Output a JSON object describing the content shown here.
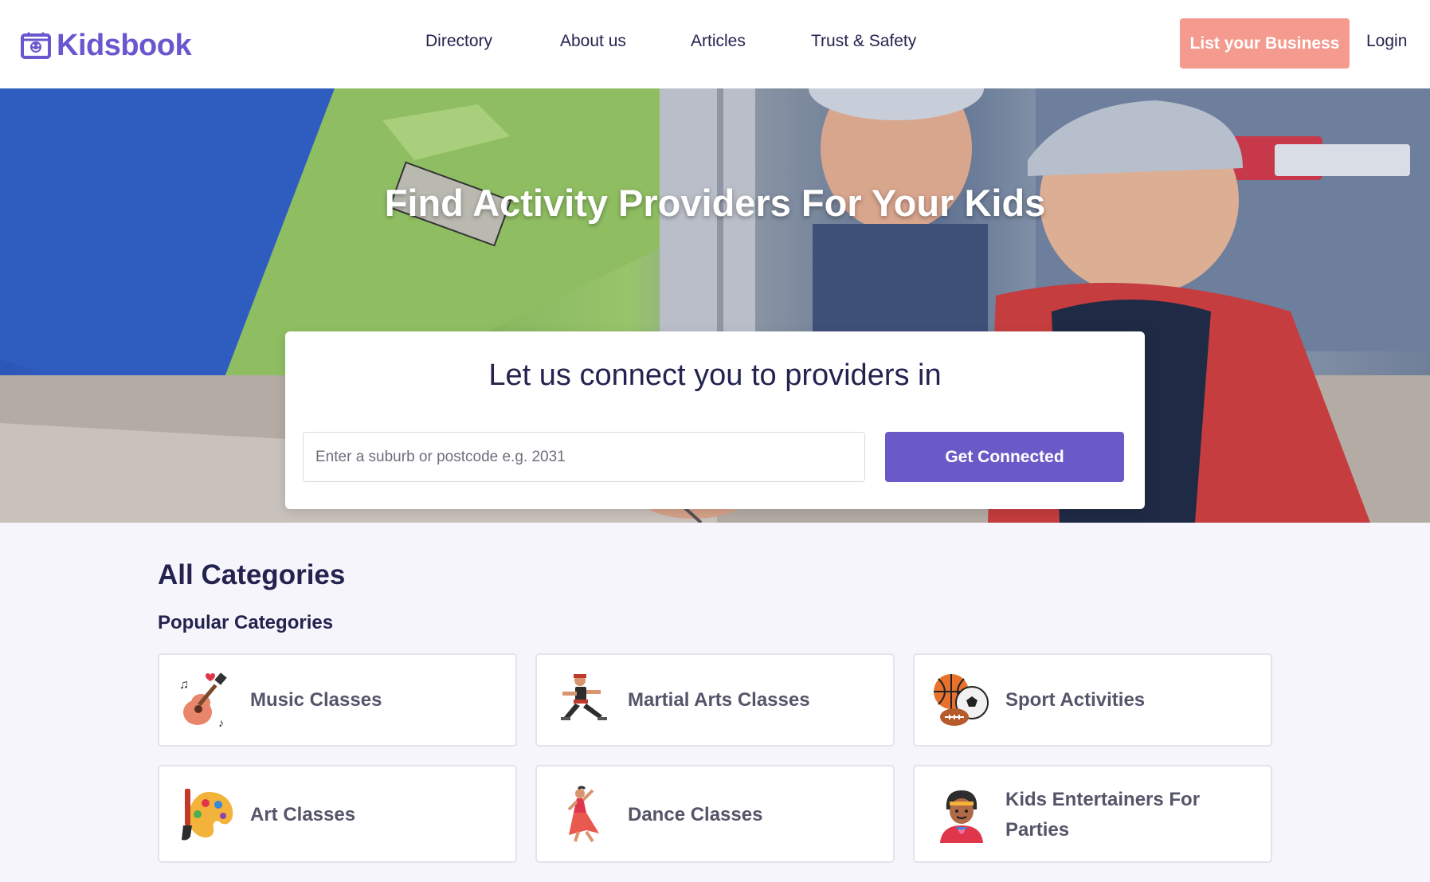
{
  "header": {
    "logo_text": "Kidsbook",
    "nav": [
      {
        "label": "Directory"
      },
      {
        "label": "About us"
      },
      {
        "label": "Articles"
      },
      {
        "label": "Trust & Safety"
      }
    ],
    "list_business_label": "List your Business",
    "login_label": "Login"
  },
  "hero": {
    "title": "Find Activity Providers For Your Kids",
    "connect": {
      "heading": "Let us connect you to providers in",
      "placeholder": "Enter a suburb or postcode e.g. 2031",
      "value": "",
      "button_label": "Get Connected"
    }
  },
  "categories": {
    "title": "All Categories",
    "subtitle": "Popular Categories",
    "items": [
      {
        "label": "Music Classes",
        "icon": "guitar-icon"
      },
      {
        "label": "Martial Arts Classes",
        "icon": "martial-arts-icon"
      },
      {
        "label": "Sport Activities",
        "icon": "sport-balls-icon"
      },
      {
        "label": "Art Classes",
        "icon": "palette-icon"
      },
      {
        "label": "Dance Classes",
        "icon": "dancer-icon"
      },
      {
        "label": "Kids Entertainers For Parties",
        "icon": "entertainer-icon"
      }
    ]
  },
  "colors": {
    "brand": "#6a57d0",
    "accent_coral": "#f59a8e",
    "button_purple": "#6a5ac8",
    "text_navy": "#23234f"
  }
}
